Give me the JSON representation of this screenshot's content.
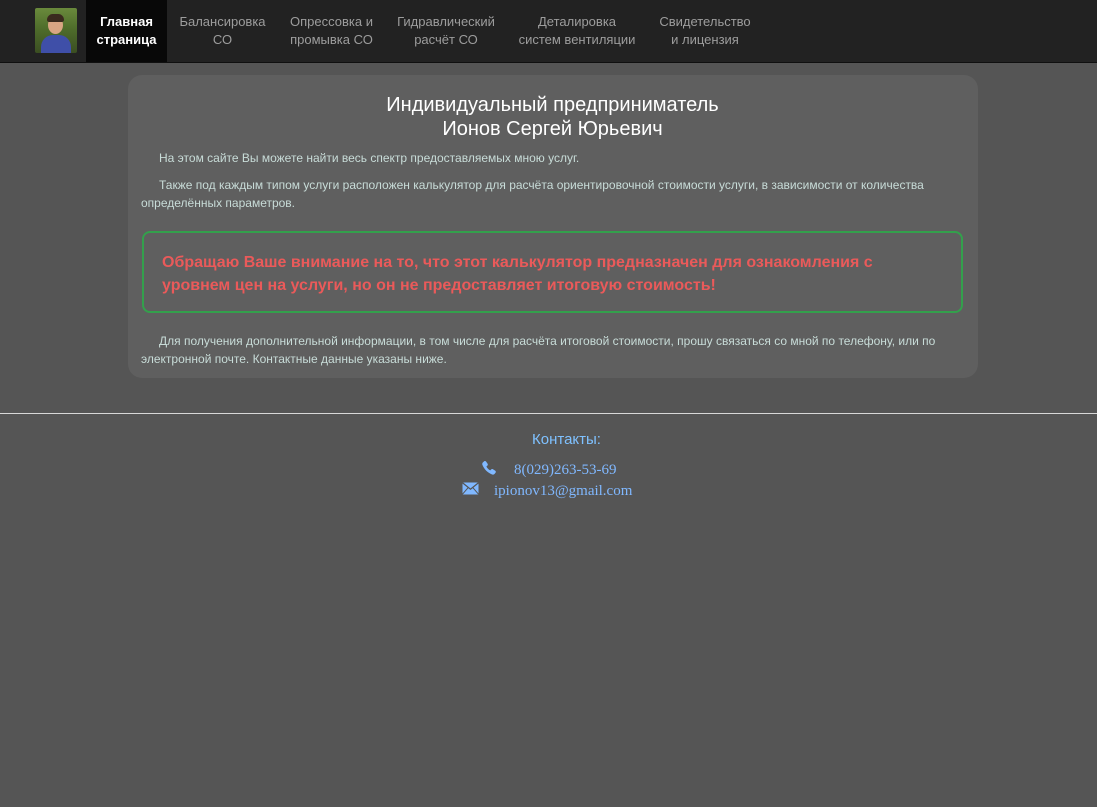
{
  "nav": {
    "items": [
      {
        "label": "Главная\nстраница"
      },
      {
        "label": "Балансировка\nСО"
      },
      {
        "label": "Опрессовка и\nпромывка СО"
      },
      {
        "label": "Гидравлический\nрасчёт СО"
      },
      {
        "label": "Деталировка\nсистем вентиляции"
      },
      {
        "label": "Свидетельство\nи лицензия"
      }
    ],
    "active_index": 0
  },
  "main": {
    "title_line1": "Индивидуальный предприниматель",
    "title_line2": "Ионов Сергей Юрьевич",
    "para1": "На этом сайте Вы можете найти весь спектр предоставляемых мною услуг.",
    "para2": "Также под каждым типом услуги расположен калькулятор для расчёта ориентировочной стоимости услуги, в зависимости от количества определённых параметров.",
    "alert": "Обращаю Ваше внимание на то, что этот калькулятор предназначен для ознакомления с уровнем цен на услуги, но он не предоставляет итоговую стоимость!",
    "para3": "Для получения дополнительной информации, в том числе для расчёта итоговой стоимости, прошу связаться со мной по телефону, или по электронной почте. Контактные данные указаны ниже."
  },
  "footer": {
    "contacts_title": "Контакты:",
    "phone": "8(029)263-53-69",
    "email": "ipionov13@gmail.com",
    "phone_icon": "phone-icon",
    "email_icon": "envelope-icon"
  },
  "colors": {
    "navbar_bg": "#222222",
    "page_bg": "#555555",
    "card_bg": "#5f5f5f",
    "alert_border": "#33a04c",
    "alert_text": "#ea5a5a",
    "link": "#80b8ff"
  }
}
